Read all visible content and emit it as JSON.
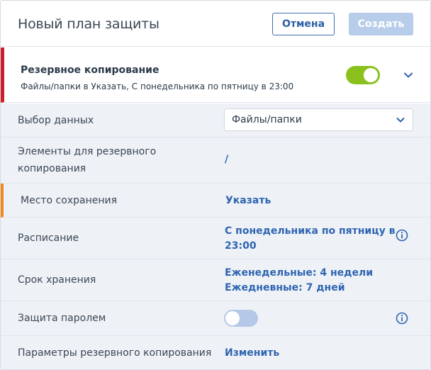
{
  "header": {
    "title": "Новый план защиты",
    "cancel_label": "Отмена",
    "create_label": "Создать"
  },
  "section": {
    "title": "Резервное копирование",
    "subtitle": "Файлы/папки в Указать, С понедельника по пятницу в 23:00",
    "enabled": true
  },
  "rows": {
    "data_selection": {
      "label": "Выбор данных",
      "value": "Файлы/папки"
    },
    "items": {
      "label_line1": "Элементы для резервного",
      "label_line2": "копирования",
      "value": "/"
    },
    "destination": {
      "label": "Место сохранения",
      "value": "Указать"
    },
    "schedule": {
      "label": "Расписание",
      "value_line1": "С понедельника по пятницу в",
      "value_line2": "23:00"
    },
    "retention": {
      "label": "Срок хранения",
      "value_line1": "Еженедельные: 4 недели",
      "value_line2": "Ежедневные: 7 дней"
    },
    "password": {
      "label": "Защита паролем",
      "enabled": false
    },
    "options": {
      "label": "Параметры резервного копирования",
      "value": "Изменить"
    }
  },
  "colors": {
    "accent_blue": "#2f64b0",
    "toggle_on": "#8bc11d",
    "toggle_off": "#b5c8e8",
    "section_marker": "#cc1f2c",
    "destination_marker": "#f08a1c",
    "row_background": "#eef2f7"
  },
  "icons": {
    "collapse": "chevron-down-icon",
    "info": "info-icon"
  }
}
